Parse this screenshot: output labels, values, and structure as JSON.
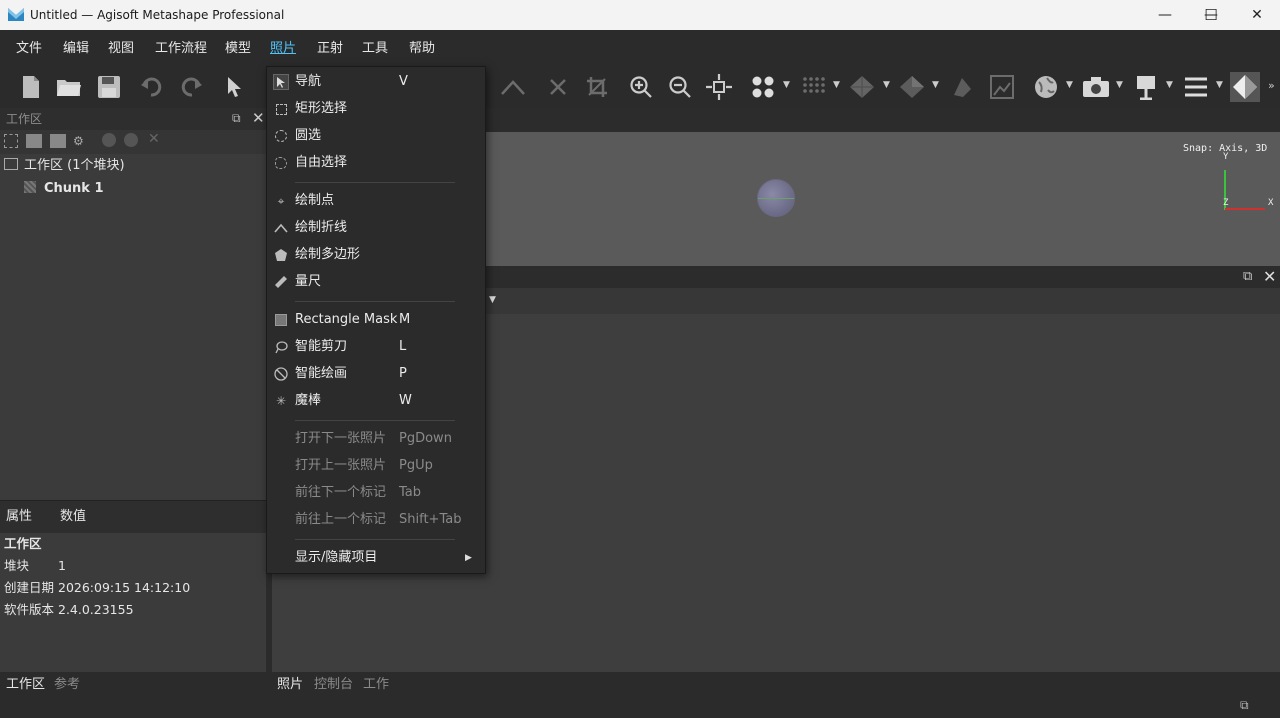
{
  "window": {
    "title": "Untitled — Agisoft Metashape Professional",
    "minimize": "—",
    "maximize": "☐",
    "close": "✕"
  },
  "menubar": {
    "items": [
      "文件",
      "编辑",
      "视图",
      "工作流程",
      "模型",
      "照片",
      "正射",
      "工具",
      "帮助"
    ],
    "active_index": 5
  },
  "workspace": {
    "header": "工作区",
    "root": "工作区 (1个堆块)",
    "chunk": "Chunk 1"
  },
  "properties": {
    "tabs": [
      "属性",
      "数值"
    ],
    "section": "工作区",
    "rows": [
      {
        "key": "堆块",
        "value": "1"
      },
      {
        "key": "创建日期",
        "value": "2026:09:15 14:12:10"
      },
      {
        "key": "软件版本",
        "value": "2.4.0.23155"
      }
    ]
  },
  "viewport": {
    "snap": "Snap: Axis, 3D",
    "axis_y": "Y",
    "axis_z": "Z",
    "axis_x": "X"
  },
  "bottom_tabs": {
    "left": [
      "工作区",
      "参考"
    ],
    "right": [
      "照片",
      "控制台",
      "工作"
    ]
  },
  "photo_menu": {
    "groups": [
      [
        {
          "icon": "cursor-icon",
          "label": "导航",
          "shortcut": "V",
          "enabled": true
        },
        {
          "icon": "rect-select-icon",
          "label": "矩形选择",
          "shortcut": "",
          "enabled": true
        },
        {
          "icon": "circle-select-icon",
          "label": "圆选",
          "shortcut": "",
          "enabled": true
        },
        {
          "icon": "free-select-icon",
          "label": "自由选择",
          "shortcut": "",
          "enabled": true
        }
      ],
      [
        {
          "icon": "draw-point-icon",
          "label": "绘制点",
          "shortcut": "",
          "enabled": true
        },
        {
          "icon": "draw-polyline-icon",
          "label": "绘制折线",
          "shortcut": "",
          "enabled": true
        },
        {
          "icon": "draw-polygon-icon",
          "label": "绘制多边形",
          "shortcut": "",
          "enabled": true
        },
        {
          "icon": "ruler-icon",
          "label": "量尺",
          "shortcut": "",
          "enabled": true
        }
      ],
      [
        {
          "icon": "rectangle-mask-icon",
          "label": "Rectangle Mask",
          "shortcut": "M",
          "enabled": true
        },
        {
          "icon": "lasso-icon",
          "label": "智能剪刀",
          "shortcut": "L",
          "enabled": true
        },
        {
          "icon": "smart-paint-icon",
          "label": "智能绘画",
          "shortcut": "P",
          "enabled": true
        },
        {
          "icon": "magic-wand-icon",
          "label": "魔棒",
          "shortcut": "W",
          "enabled": true
        }
      ],
      [
        {
          "icon": "",
          "label": "打开下一张照片",
          "shortcut": "PgDown",
          "enabled": false
        },
        {
          "icon": "",
          "label": "打开上一张照片",
          "shortcut": "PgUp",
          "enabled": false
        },
        {
          "icon": "",
          "label": "前往下一个标记",
          "shortcut": "Tab",
          "enabled": false
        },
        {
          "icon": "",
          "label": "前往上一个标记",
          "shortcut": "Shift+Tab",
          "enabled": false
        }
      ],
      [
        {
          "icon": "",
          "label": "显示/隐藏项目",
          "shortcut": "",
          "enabled": true,
          "submenu": true
        }
      ]
    ]
  }
}
